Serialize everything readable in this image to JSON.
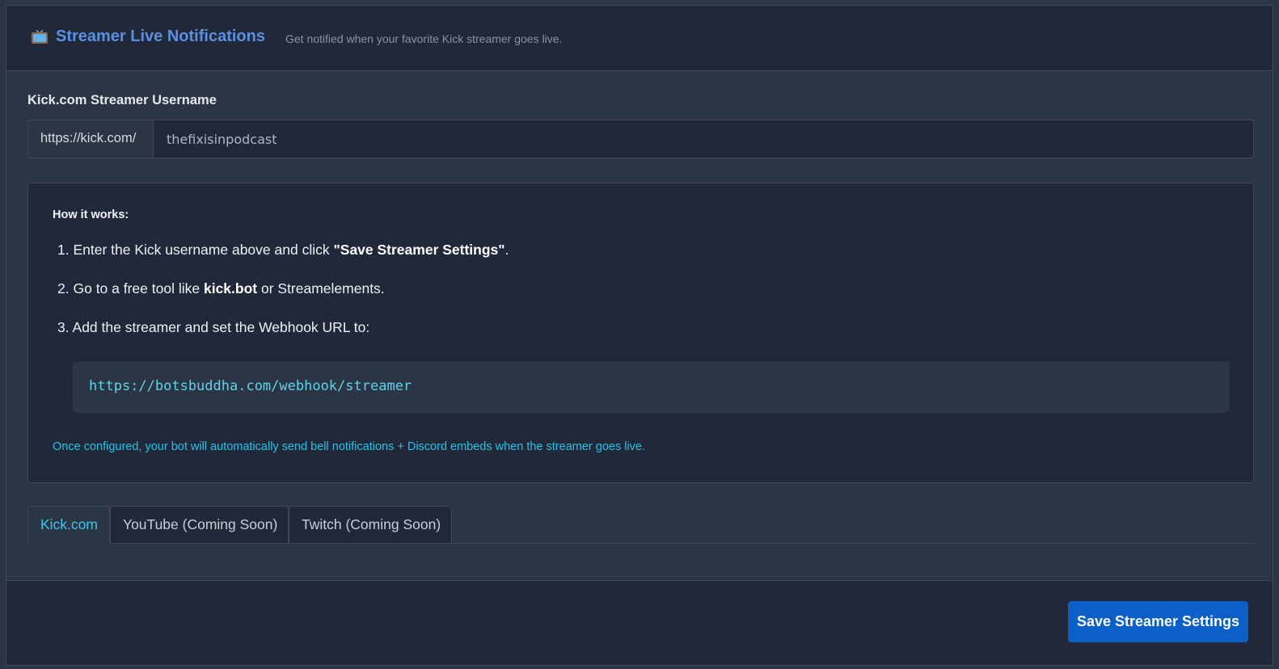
{
  "header": {
    "icon": "tv-icon",
    "title": "Streamer Live Notifications",
    "subtitle": "Get notified when your favorite Kick streamer goes live."
  },
  "username": {
    "label": "Kick.com Streamer Username",
    "prefix": "https://kick.com/",
    "value": "thefixisinpodcast"
  },
  "how_it_works": {
    "heading": "How it works:",
    "steps": [
      {
        "number": "1.",
        "text_before": "Enter the Kick username above and click ",
        "bold": "\"Save Streamer Settings\"",
        "text_after": "."
      },
      {
        "number": "2.",
        "text_before": "Go to a free tool like ",
        "bold": "kick.bot",
        "text_after": " or Streamelements."
      },
      {
        "number": "3.",
        "text_before": "Add the streamer and set the Webhook URL to:",
        "bold": "",
        "text_after": ""
      }
    ],
    "webhook_url": "https://botsbuddha.com/webhook/streamer",
    "note": "Once configured, your bot will automatically send bell notifications + Discord embeds when the streamer goes live."
  },
  "tabs": [
    {
      "label": "Kick.com",
      "active": true
    },
    {
      "label": "YouTube (Coming Soon)",
      "active": false
    },
    {
      "label": "Twitch (Coming Soon)",
      "active": false
    }
  ],
  "footer": {
    "save_label": "Save Streamer Settings"
  },
  "colors": {
    "accent": "#5b8fe0",
    "active_tab": "#38c6ee",
    "button": "#0b5fc6",
    "code": "#5ed3ec"
  }
}
